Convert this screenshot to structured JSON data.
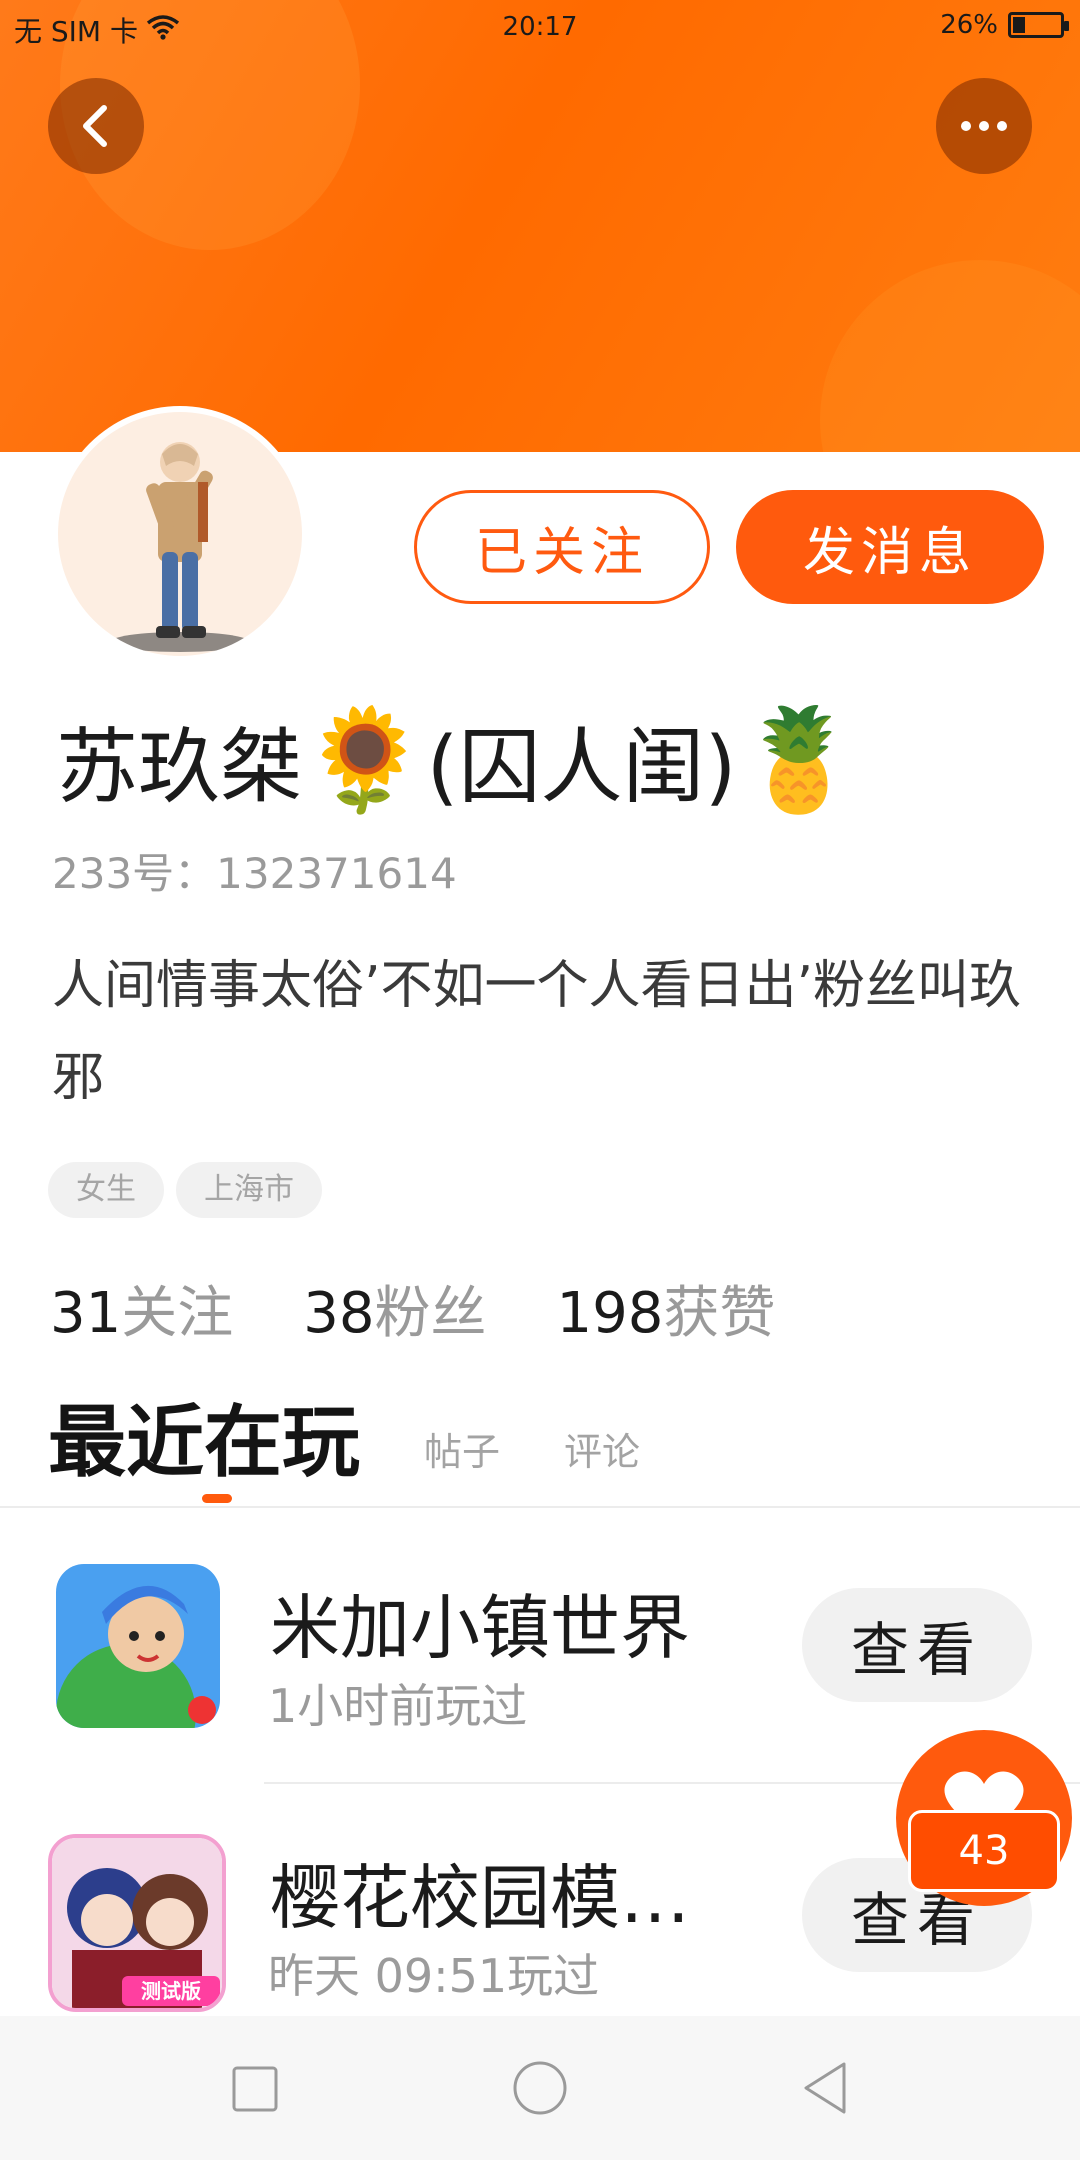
{
  "status_bar": {
    "carrier": "无 SIM 卡",
    "time": "20:17",
    "battery_percent": "26%",
    "battery_level": 0.26
  },
  "header": {
    "back_icon": "chevron-left-icon",
    "more_icon": "more-horizontal-icon"
  },
  "profile": {
    "name": "苏玖桀",
    "name_suffix": "(囚人闺)",
    "emoji_1": "🌻",
    "emoji_2": "🍍",
    "id_line": "233号：132371614",
    "bio": "人间情事太俗’不如一个人看日出’粉丝叫玖邪",
    "tags": [
      "女生",
      "上海市"
    ],
    "follow_label": "已关注",
    "message_label": "发消息"
  },
  "stats": {
    "following_num": "31",
    "following_label": "关注",
    "fans_num": "38",
    "fans_label": "粉丝",
    "likes_num": "198",
    "likes_label": "获赞"
  },
  "tabs": {
    "active": "最近在玩",
    "posts": "帖子",
    "comments": "评论"
  },
  "games": [
    {
      "title": "米加小镇世界",
      "subtitle": "1小时前玩过",
      "action": "查看"
    },
    {
      "title": "樱花校园模…",
      "subtitle": "昨天 09:51玩过",
      "action": "查看",
      "badge": "测试版"
    }
  ],
  "floating_like": {
    "count": "43"
  },
  "colors": {
    "accent": "#ff5a0d",
    "banner": "#ff6a00"
  }
}
